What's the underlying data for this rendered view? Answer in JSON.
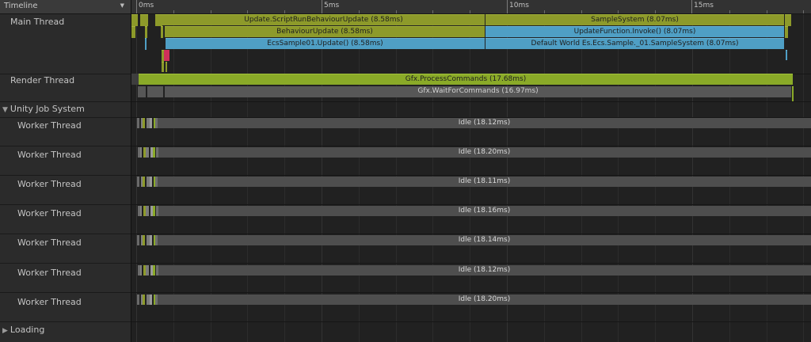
{
  "panel": {
    "title": "Timeline"
  },
  "tracks": {
    "main": "Main Thread",
    "render": "Render Thread",
    "job_system": "Unity Job System",
    "worker": "Worker Thread",
    "loading": "Loading"
  },
  "ruler": {
    "labels": [
      "0ms",
      "5ms",
      "10ms",
      "15ms"
    ]
  },
  "main_thread": {
    "update_script": "Update.ScriptRunBehaviourUpdate (8.58ms)",
    "sample_system": "SampleSystem (8.07ms)",
    "behaviour_update": "BehaviourUpdate (8.58ms)",
    "update_function": "UpdateFunction.Invoke() (8.07ms)",
    "ecs_sample": "EcsSample01.Update() (8.58ms)",
    "default_world": "Default World Es.Ecs.Sample._01.SampleSystem (8.07ms)"
  },
  "render_thread": {
    "process_commands": "Gfx.ProcessCommands (17.68ms)",
    "wait_for_commands": "Gfx.WaitForCommands (16.97ms)"
  },
  "workers": [
    {
      "idle": "Idle (18.12ms)"
    },
    {
      "idle": "Idle (18.20ms)"
    },
    {
      "idle": "Idle (18.11ms)"
    },
    {
      "idle": "Idle (18.16ms)"
    },
    {
      "idle": "Idle (18.14ms)"
    },
    {
      "idle": "Idle (18.12ms)"
    },
    {
      "idle": "Idle (18.20ms)"
    }
  ],
  "colors": {
    "olive": "#8d9a2a",
    "blue": "#4f9fc5",
    "green": "#8aaa28",
    "grey": "#575757",
    "idle": "#4e4e4e",
    "marker_red": "#d0305a"
  }
}
